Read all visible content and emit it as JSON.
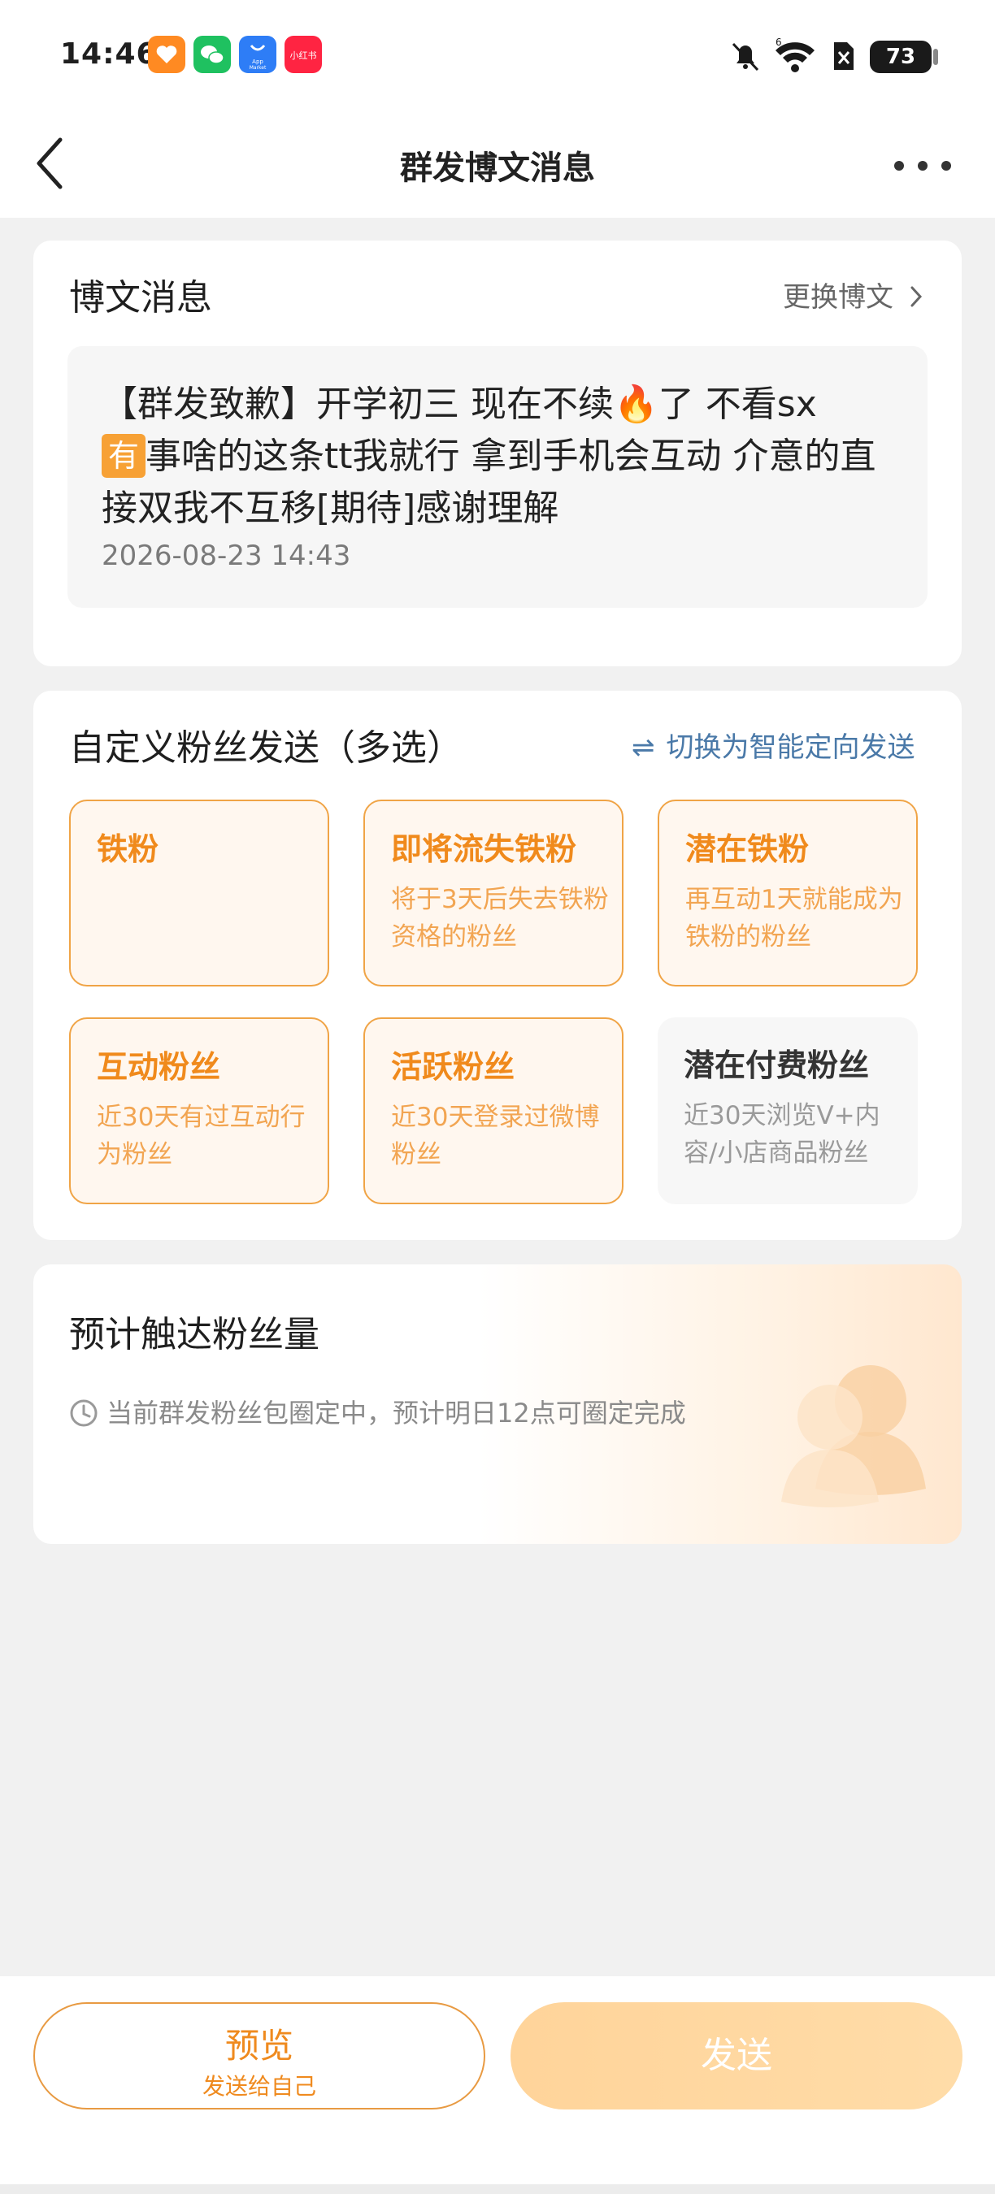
{
  "status_bar": {
    "time": "14:46",
    "battery": "73",
    "apps": [
      {
        "name": "heart-app-icon",
        "color": "#ff8a22"
      },
      {
        "name": "wechat-icon",
        "color": "#1fc160"
      },
      {
        "name": "app-market-icon",
        "color": "#2e7df6",
        "text": "App Market"
      },
      {
        "name": "xiaohongshu-icon",
        "color": "#ff2442",
        "text": "小红书"
      }
    ]
  },
  "nav": {
    "title": "群发博文消息"
  },
  "post_card": {
    "title": "博文消息",
    "change_link": "更换博文",
    "content_part1": "【群发致歉】开学初三 现在不续",
    "fire_emoji": "🔥",
    "content_part2": "了 不看sx",
    "you_badge": "有",
    "content_part3": "事啥的这条tt我就行 拿到手机会互动 介意的直接双我不互移[期待]感谢理解",
    "timestamp": "2026-08-23 14:43"
  },
  "fans_card": {
    "title": "自定义粉丝发送（多选）",
    "switch_icon": "⇌",
    "switch_link": "切换为智能定向发送",
    "options": [
      {
        "title": "铁粉",
        "desc": "",
        "selected": true
      },
      {
        "title": "即将流失铁粉",
        "desc": "将于3天后失去铁粉资格的粉丝",
        "selected": true
      },
      {
        "title": "潜在铁粉",
        "desc": "再互动1天就能成为铁粉的粉丝",
        "selected": true
      },
      {
        "title": "互动粉丝",
        "desc": "近30天有过互动行为粉丝",
        "selected": true
      },
      {
        "title": "活跃粉丝",
        "desc": "近30天登录过微博粉丝",
        "selected": true
      },
      {
        "title": "潜在付费粉丝",
        "desc": "近30天浏览V+内容/小店商品粉丝",
        "selected": false
      }
    ]
  },
  "reach_card": {
    "title": "预计触达粉丝量",
    "status": "当前群发粉丝包圈定中，预计明日12点可圈定完成"
  },
  "bottom": {
    "preview_label": "预览",
    "preview_sub": "发送给自己",
    "send_label": "发送"
  },
  "colors": {
    "accent": "#f08a1c",
    "link_blue": "#4a79a8",
    "send_disabled": "#ffd49a"
  }
}
